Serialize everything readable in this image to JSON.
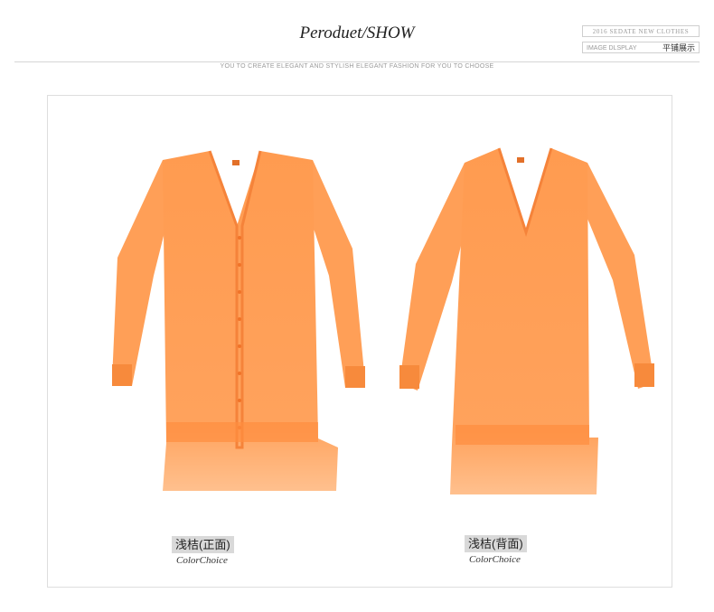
{
  "header": {
    "title": "Peroduet/SHOW",
    "tagline": "YOU TO CREATE ELEGANT AND STYLISH ELEGANT FASHION FOR YOU TO CHOOSE",
    "badge_top": "2016 SEDATE NEW CLOTHES",
    "badge_bottom_en": "IMAGE DLSPLAY",
    "badge_bottom_cn": "平铺展示"
  },
  "products": [
    {
      "label": "浅桔(正面)",
      "sub": "ColorChoice",
      "view": "front"
    },
    {
      "label": "浅桔(背面)",
      "sub": "ColorChoice",
      "view": "back"
    }
  ],
  "colors": {
    "garment": "#ff9a4e",
    "garment_dark": "#f77e2c",
    "hem_light": "#ffc596"
  }
}
